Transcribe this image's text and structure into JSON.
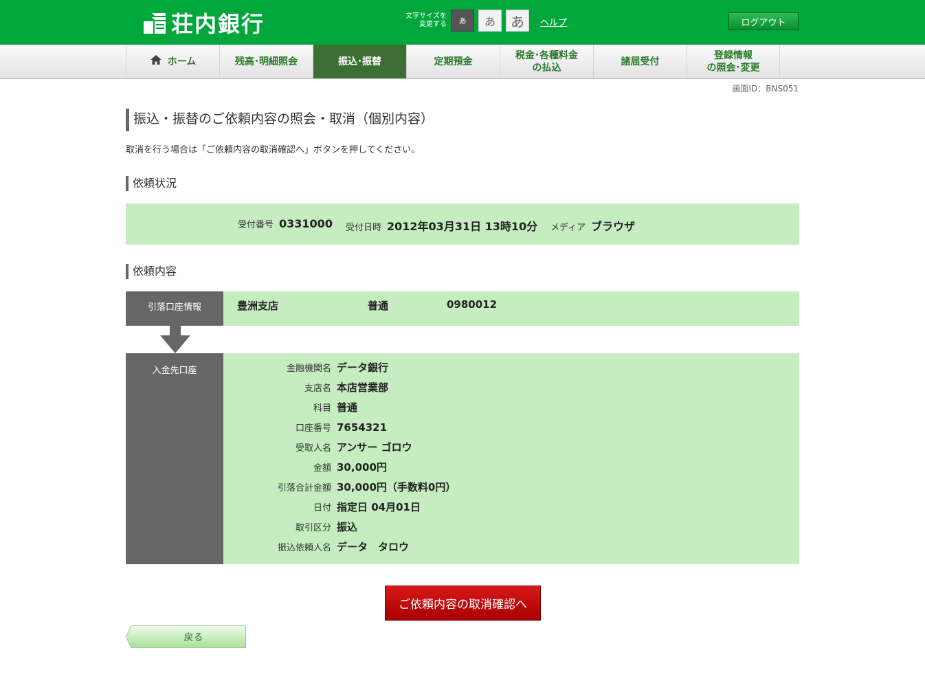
{
  "header": {
    "bank_name": "荘内銀行",
    "font_size_label_1": "文字サイズを",
    "font_size_label_2": "変更する",
    "font_small": "あ",
    "font_medium": "あ",
    "font_large": "あ",
    "help": "ヘルプ",
    "logout": "ログアウト"
  },
  "nav": {
    "items": [
      {
        "label": "ホーム"
      },
      {
        "label": "残高･明細照会"
      },
      {
        "label": "振込･振替"
      },
      {
        "label": "定期預金"
      },
      {
        "label_1": "税金･各種料金",
        "label_2": "の払込"
      },
      {
        "label": "諸届受付"
      },
      {
        "label_1": "登録情報",
        "label_2": "の照会･変更"
      }
    ],
    "active_index": 2
  },
  "screen_id": "画面ID：BNS051",
  "page": {
    "title": "振込・振替のご依頼内容の照会・取消（個別内容）",
    "description": "取消を行う場合は「ご依頼内容の取消確認へ」ボタンを押してください。"
  },
  "status": {
    "heading": "依頼状況",
    "receipt_no_label": "受付番号",
    "receipt_no": "0331000",
    "receipt_time_label": "受付日時",
    "receipt_time": "2012年03月31日 13時10分",
    "media_label": "メディア",
    "media": "ブラウザ"
  },
  "request": {
    "heading": "依頼内容",
    "debit": {
      "label": "引落口座情報",
      "branch": "豊洲支店",
      "type": "普通",
      "account": "0980012"
    },
    "credit": {
      "label": "入金先口座",
      "rows": [
        {
          "key": "金融機関名",
          "value": "データ銀行"
        },
        {
          "key": "支店名",
          "value": "本店営業部"
        },
        {
          "key": "科目",
          "value": "普通"
        },
        {
          "key": "口座番号",
          "value": "7654321"
        },
        {
          "key": "受取人名",
          "value": "アンサー ゴロウ"
        },
        {
          "key": "金額",
          "value": "30,000円"
        },
        {
          "key": "引落合計金額",
          "value": "30,000円（手数料0円）"
        },
        {
          "key": "日付",
          "value": "指定日 04月01日"
        },
        {
          "key": "取引区分",
          "value": "振込"
        },
        {
          "key": "振込依頼人名",
          "value": "データ　タロウ"
        }
      ]
    }
  },
  "buttons": {
    "cancel_confirm": "ご依頼内容の取消確認へ",
    "back": "戻る"
  },
  "colors": {
    "brand_green": "#00a83c",
    "panel_green": "#c5edc0",
    "label_gray": "#666666",
    "cancel_red": "#c00000"
  }
}
